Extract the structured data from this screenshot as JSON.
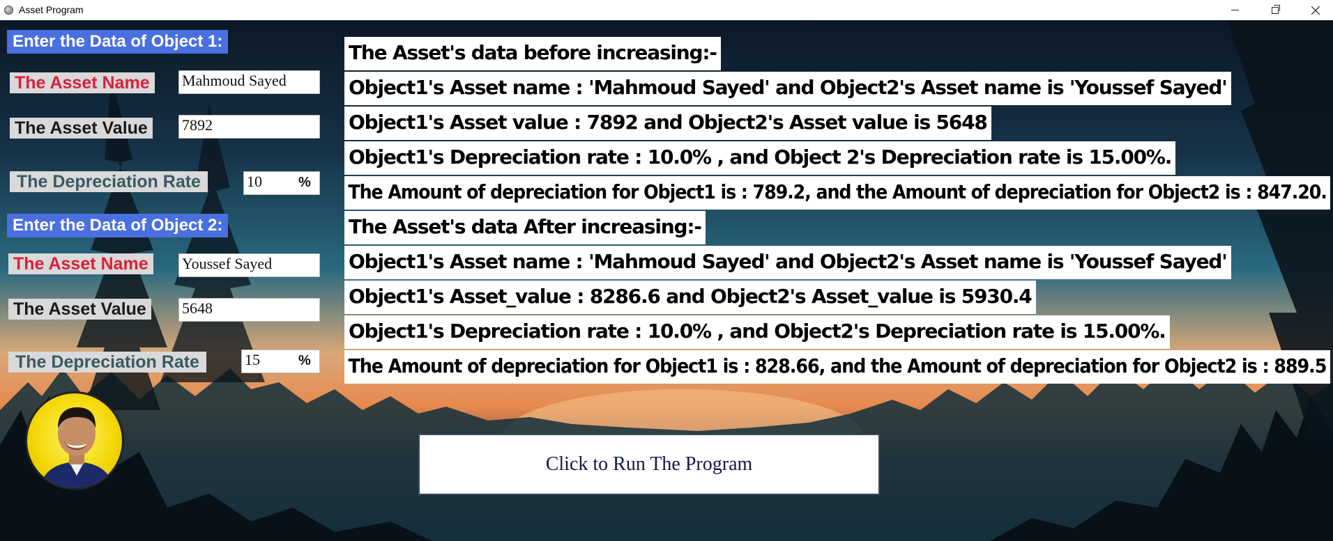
{
  "window": {
    "title": "Asset Program"
  },
  "object1": {
    "header": "Enter the Data of Object 1:",
    "name_label": "The Asset Name",
    "name_value": "Mahmoud Sayed",
    "value_label": "The Asset Value",
    "value_value": "7892",
    "rate_label": "The Depreciation Rate",
    "rate_value": "10",
    "rate_unit": "%"
  },
  "object2": {
    "header": "Enter the Data of Object 2:",
    "name_label": "The Asset Name",
    "name_value": "Youssef Sayed",
    "value_label": "The Asset Value",
    "value_value": "5648",
    "rate_label": "The Depreciation Rate",
    "rate_value": "15",
    "rate_unit": "%"
  },
  "output": {
    "before_title": "The Asset's data before increasing:-",
    "before_name": " Object1's Asset name : 'Mahmoud Sayed' and Object2's Asset name is 'Youssef Sayed'",
    "before_value": " Object1's Asset value : 7892 and Object2's Asset value is 5648",
    "before_rate": " Object1's Depreciation rate : 10.0% , and Object 2's Depreciation rate is 15.00%.",
    "before_amount": "The Amount of depreciation for Object1 is : 789.2, and the Amount of depreciation for Object2 is : 847.20.",
    "after_title": "The Asset's data After increasing:-",
    "after_name": " Object1's Asset name : 'Mahmoud Sayed' and Object2's Asset name is 'Youssef Sayed'",
    "after_value": " Object1's Asset_value : 8286.6 and Object2's Asset_value is 5930.4",
    "after_rate": " Object1's Depreciation rate : 10.0% , and Object2's Depreciation rate is 15.00%.",
    "after_amount": "The Amount of depreciation for Object1 is : 828.66, and the Amount of depreciation for Object2 is : 889.5"
  },
  "run_button": {
    "label": "Click to Run The Program"
  }
}
